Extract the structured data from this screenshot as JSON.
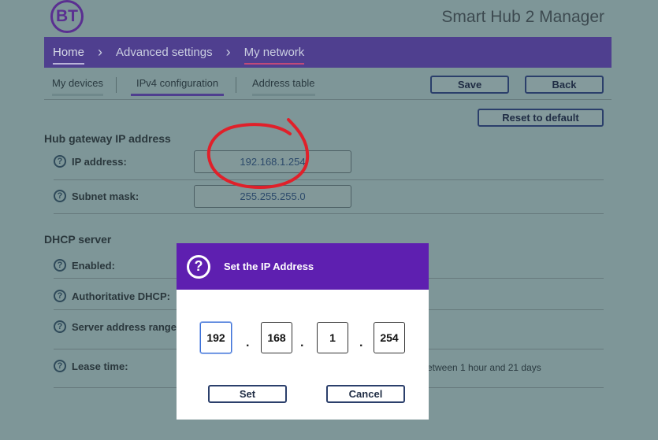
{
  "header": {
    "logo_text": "BT",
    "app_title": "Smart Hub 2 Manager"
  },
  "nav": {
    "items": [
      {
        "label": "Home"
      },
      {
        "label": "Advanced settings"
      },
      {
        "label": "My network"
      }
    ]
  },
  "tabs": {
    "items": [
      {
        "label": "My devices"
      },
      {
        "label": "IPv4 configuration"
      },
      {
        "label": "Address table"
      }
    ]
  },
  "toolbar": {
    "save_label": "Save",
    "back_label": "Back",
    "reset_label": "Reset to default"
  },
  "gateway": {
    "title": "Hub gateway IP address",
    "ip_label": "IP address:",
    "ip_value": "192.168.1.254",
    "subnet_label": "Subnet mask:",
    "subnet_value": "255.255.255.0"
  },
  "dhcp": {
    "title": "DHCP server",
    "enabled_label": "Enabled:",
    "authoritative_label": "Authoritative DHCP:",
    "range_label": "Server address range:",
    "lease_label": "Lease time:",
    "lease_note": "etween 1 hour and 21 days"
  },
  "modal": {
    "title": "Set the IP Address",
    "octets": [
      "192",
      "168",
      "1",
      "254"
    ],
    "set_label": "Set",
    "cancel_label": "Cancel"
  },
  "colors": {
    "nav_bg": "#4f3f8f",
    "modal_header": "#5e1fb0",
    "annotation": "#e0202a"
  },
  "icons": {
    "help": "question-circle-icon",
    "nav_separator": "chevron-right-icon"
  }
}
